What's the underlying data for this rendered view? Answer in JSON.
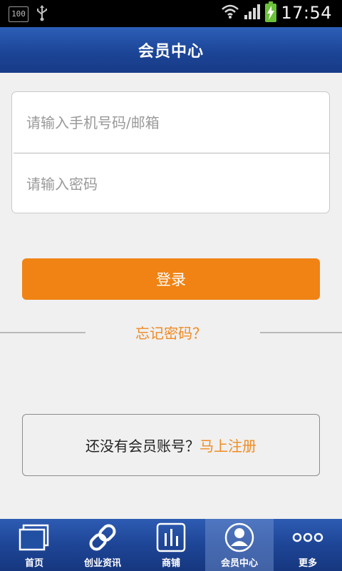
{
  "status_bar": {
    "battery_left": "100",
    "time": "17:54"
  },
  "header": {
    "title": "会员中心"
  },
  "login": {
    "phone_placeholder": "请输入手机号码/邮箱",
    "password_placeholder": "请输入密码",
    "login_label": "登录",
    "forgot_label": "忘记密码？"
  },
  "register": {
    "prompt": "还没有会员账号？",
    "link": "马上注册"
  },
  "tabbar": {
    "items": [
      {
        "label": "首页",
        "icon": "home-icon"
      },
      {
        "label": "创业资讯",
        "icon": "link-icon"
      },
      {
        "label": "商铺",
        "icon": "bars-icon"
      },
      {
        "label": "会员中心",
        "icon": "user-icon",
        "active": true
      },
      {
        "label": "更多",
        "icon": "more-icon"
      }
    ]
  },
  "colors": {
    "accent_orange": "#f08314",
    "header_blue": "#1c4597",
    "link_orange": "#ee8a25"
  }
}
